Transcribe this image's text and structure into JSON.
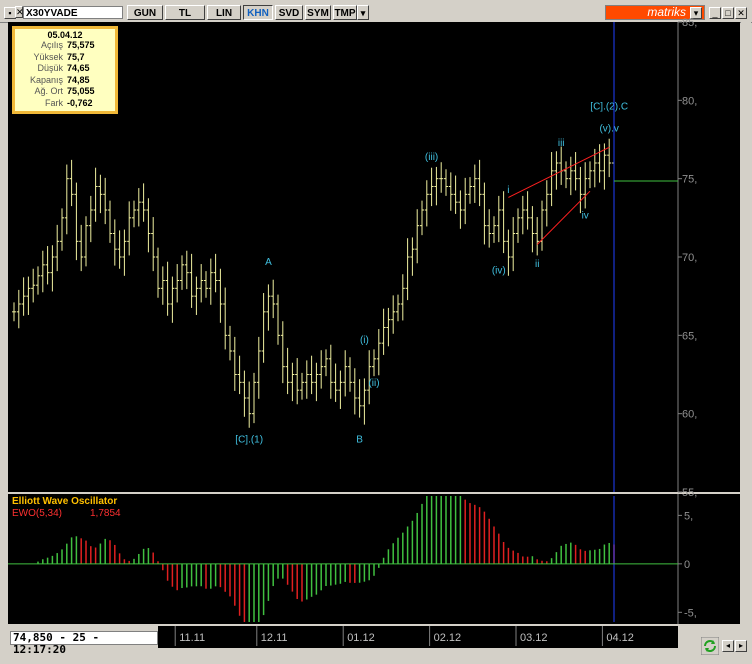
{
  "toolbar": {
    "symbol": "X30YVADE",
    "buttons": [
      "GUN",
      "TL",
      "LIN",
      "KHN",
      "SVD",
      "SYM",
      "TMP"
    ],
    "active_button": "KHN",
    "brand": "matriks"
  },
  "info_box": {
    "date": "05.04.12",
    "rows": [
      {
        "label": "Açılış",
        "value": "75,575"
      },
      {
        "label": "Yüksek",
        "value": "75,7"
      },
      {
        "label": "Düşük",
        "value": "74,65"
      },
      {
        "label": "Kapanış",
        "value": "74,85"
      },
      {
        "label": "Ağ. Ort",
        "value": "75,055"
      },
      {
        "label": "Fark",
        "value": "-0,762"
      }
    ]
  },
  "status": {
    "value_display": "74,850 - 25 - 12:17:20"
  },
  "colors": {
    "background": "#000000",
    "price_bar": "#f0f0a0",
    "wave_label": "#40c0e0",
    "channel_line": "#ff2020",
    "price_line": "#40c040",
    "osc_positive": "#40c040",
    "osc_negative": "#e02020",
    "osc_title": "#ffc000",
    "osc_label": "#ff3030"
  },
  "chart_data": [
    {
      "type": "ohlc",
      "y_ticks": [
        "55,",
        "60,",
        "65,",
        "70,",
        "75,",
        "80,",
        "85,"
      ],
      "ylim": [
        55,
        85
      ],
      "x_ticks": [
        "11.11",
        "12.11",
        "01.12",
        "02.12",
        "03.12",
        "04.12"
      ],
      "current_price": 74.85,
      "closes": [
        66.5,
        67.0,
        67.5,
        68.0,
        68.2,
        68.8,
        69.5,
        69.0,
        70.0,
        71.0,
        72.5,
        75.0,
        74.0,
        71.0,
        70.0,
        72.0,
        73.0,
        74.5,
        74.0,
        73.0,
        71.5,
        70.5,
        70.0,
        71.0,
        72.5,
        73.0,
        73.5,
        73.0,
        71.5,
        70.0,
        68.0,
        68.5,
        67.0,
        68.0,
        68.5,
        69.5,
        69.0,
        67.5,
        68.0,
        68.5,
        68.0,
        69.0,
        68.5,
        67.0,
        65.0,
        64.0,
        62.5,
        62.0,
        61.0,
        60.0,
        62.0,
        64.0,
        66.5,
        67.5,
        67.0,
        65.0,
        63.0,
        62.0,
        62.5,
        61.5,
        62.0,
        62.5,
        62.0,
        62.5,
        63.0,
        63.5,
        62.0,
        61.5,
        62.0,
        63.0,
        62.0,
        61.0,
        60.5,
        61.5,
        63.0,
        63.5,
        64.5,
        65.5,
        66.0,
        66.5,
        67.0,
        68.0,
        70.0,
        70.5,
        72.0,
        73.0,
        74.0,
        74.5,
        75.0,
        75.0,
        74.5,
        74.0,
        73.5,
        73.0,
        74.0,
        74.5,
        75.0,
        74.0,
        72.0,
        71.5,
        72.0,
        73.0,
        71.0,
        70.0,
        71.5,
        72.5,
        73.0,
        72.5,
        71.5,
        71.0,
        73.0,
        74.0,
        75.5,
        76.0,
        75.5,
        75.0,
        75.5,
        75.0,
        74.0,
        75.0,
        75.5,
        76.0,
        75.5,
        76.5,
        76.0,
        74.85
      ],
      "annotations": [
        {
          "text": "[C].(1)",
          "index": 49,
          "price": 58.8,
          "pos": "below"
        },
        {
          "text": "A",
          "index": 53,
          "price": 69.5,
          "pos": "above"
        },
        {
          "text": "B",
          "index": 72,
          "price": 58.8,
          "pos": "below"
        },
        {
          "text": "(i)",
          "index": 73,
          "price": 64.5,
          "pos": "above"
        },
        {
          "text": "(ii)",
          "index": 75,
          "price": 62.4,
          "pos": "below"
        },
        {
          "text": "(iii)",
          "index": 87,
          "price": 76.2,
          "pos": "above"
        },
        {
          "text": "(iv)",
          "index": 101,
          "price": 69.6,
          "pos": "below"
        },
        {
          "text": "i",
          "index": 103,
          "price": 74.1,
          "pos": "above"
        },
        {
          "text": "ii",
          "index": 109,
          "price": 70.0,
          "pos": "below"
        },
        {
          "text": "iii",
          "index": 114,
          "price": 77.1,
          "pos": "above"
        },
        {
          "text": "iv",
          "index": 119,
          "price": 73.1,
          "pos": "below"
        },
        {
          "text": "(v).v",
          "index": 124,
          "price": 78.0,
          "pos": "above"
        },
        {
          "text": "[C].(2).C",
          "index": 124,
          "price": 79.4,
          "pos": "above"
        }
      ],
      "channel": [
        {
          "from_index": 103,
          "from_price": 73.8,
          "to_index": 124,
          "to_price": 77.0
        },
        {
          "from_index": 109,
          "from_price": 70.8,
          "to_index": 120,
          "to_price": 74.2
        }
      ]
    },
    {
      "type": "bar",
      "title": "Elliott Wave Oscillator",
      "series_label": "EWO(5,34)",
      "series_value": "1,7854",
      "y_ticks": [
        "5,",
        "0",
        "-5,"
      ],
      "ylim": [
        -6,
        7
      ]
    }
  ]
}
